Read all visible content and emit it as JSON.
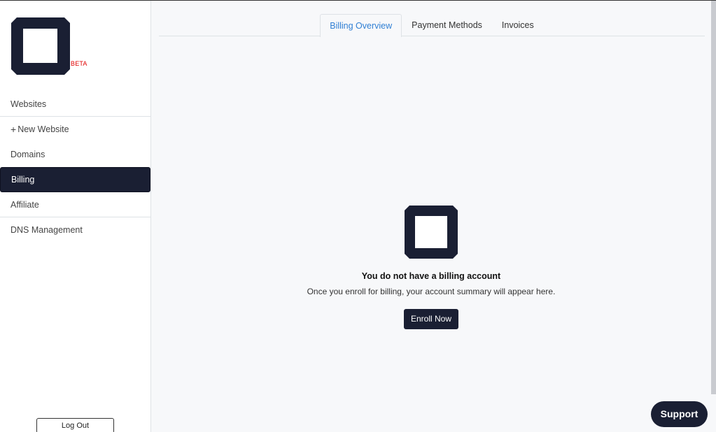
{
  "brand": {
    "beta_label": "BETA",
    "logo_icon": "octagon-square-logo-icon",
    "logo_color": "#1a1f33"
  },
  "sidebar": {
    "items": [
      {
        "label": "Websites"
      },
      {
        "label": "New Website",
        "icon": "plus-icon",
        "icon_glyph": "+"
      },
      {
        "label": "Domains"
      },
      {
        "label": "Billing",
        "active": true
      },
      {
        "label": "Affiliate"
      },
      {
        "label": "DNS Management"
      }
    ],
    "logout_label": "Log Out"
  },
  "tabs": [
    {
      "label": "Billing Overview",
      "active": true
    },
    {
      "label": "Payment Methods"
    },
    {
      "label": "Invoices"
    }
  ],
  "empty_state": {
    "icon": "octagon-square-logo-icon",
    "title": "You do not have a billing account",
    "description": "Once you enroll for billing, your account summary will appear here.",
    "button_label": "Enroll Now"
  },
  "support": {
    "label": "Support"
  },
  "colors": {
    "accent": "#2f7fd4",
    "dark": "#1a1f33",
    "beta": "#e00000"
  }
}
